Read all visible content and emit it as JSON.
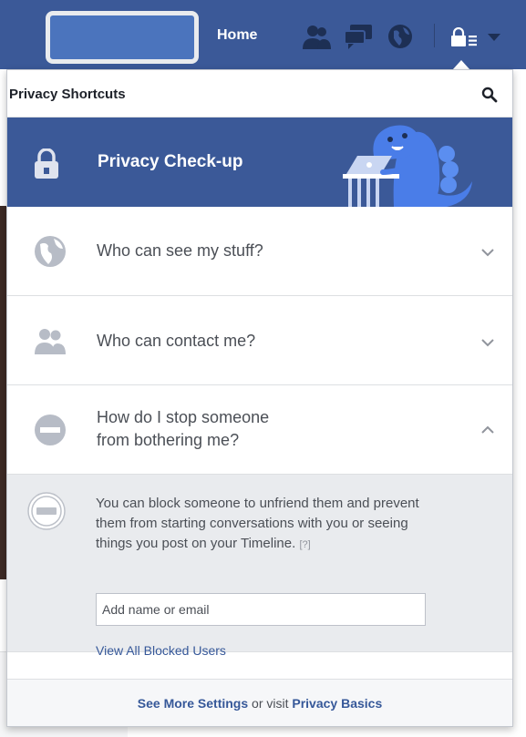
{
  "topbar": {
    "home_label": "Home",
    "icons": [
      "friends-icon",
      "messages-icon",
      "notifications-globe-icon",
      "privacy-lock-icon",
      "account-caret-icon"
    ]
  },
  "panel": {
    "title": "Privacy Shortcuts",
    "checkup_label": "Privacy Check-up",
    "rows": [
      {
        "label": "Who can see my stuff?",
        "icon": "globe-icon"
      },
      {
        "label": "Who can contact me?",
        "icon": "people-icon"
      },
      {
        "label_line1": "How do I stop someone",
        "label_line2": "from bothering me?",
        "icon": "block-icon"
      }
    ],
    "block_description": "You can block someone to unfriend them and prevent them from starting conversations with you or seeing things you post on your Timeline.",
    "help_link": "[?]",
    "input_placeholder": "Add name or email",
    "view_blocked_link": "View All Blocked Users",
    "footer": {
      "see_more": "See More Settings",
      "or_visit": " or visit ",
      "privacy_basics": "Privacy Basics"
    }
  },
  "colors": {
    "brand_blue": "#3b5998",
    "link_blue": "#365899",
    "panel_grey": "#e9ebee"
  }
}
